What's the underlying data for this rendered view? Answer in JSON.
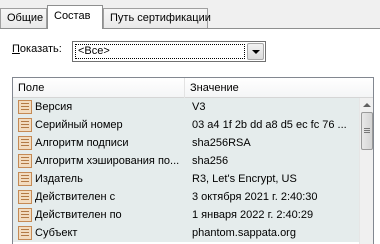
{
  "tabs": [
    {
      "label": "Общие"
    },
    {
      "label": "Состав"
    },
    {
      "label": "Путь сертификации"
    }
  ],
  "show": {
    "label_prefix": "П",
    "label_rest": "оказать:",
    "selected": "<Все>"
  },
  "list": {
    "columns": {
      "field": "Поле",
      "value": "Значение"
    },
    "rows": [
      {
        "name": "Версия",
        "value": "V3"
      },
      {
        "name": "Серийный номер",
        "value": "03 a4 1f 2b dd a8 d5 ec fc 76 ..."
      },
      {
        "name": "Алгоритм подписи",
        "value": "sha256RSA"
      },
      {
        "name": "Алгоритм хэширования по...",
        "value": "sha256"
      },
      {
        "name": "Издатель",
        "value": "R3, Let's Encrypt, US"
      },
      {
        "name": "Действителен с",
        "value": "3 октября 2021 г. 2:40:30"
      },
      {
        "name": "Действителен по",
        "value": "1 января 2022 г. 2:40:29"
      },
      {
        "name": "Субъект",
        "value": "phantom.sappata.org"
      }
    ]
  },
  "icons": {
    "dropdown": "chevron-down-icon",
    "field": "certificate-field-icon",
    "scroll_up": "scroll-up-arrow-icon"
  }
}
